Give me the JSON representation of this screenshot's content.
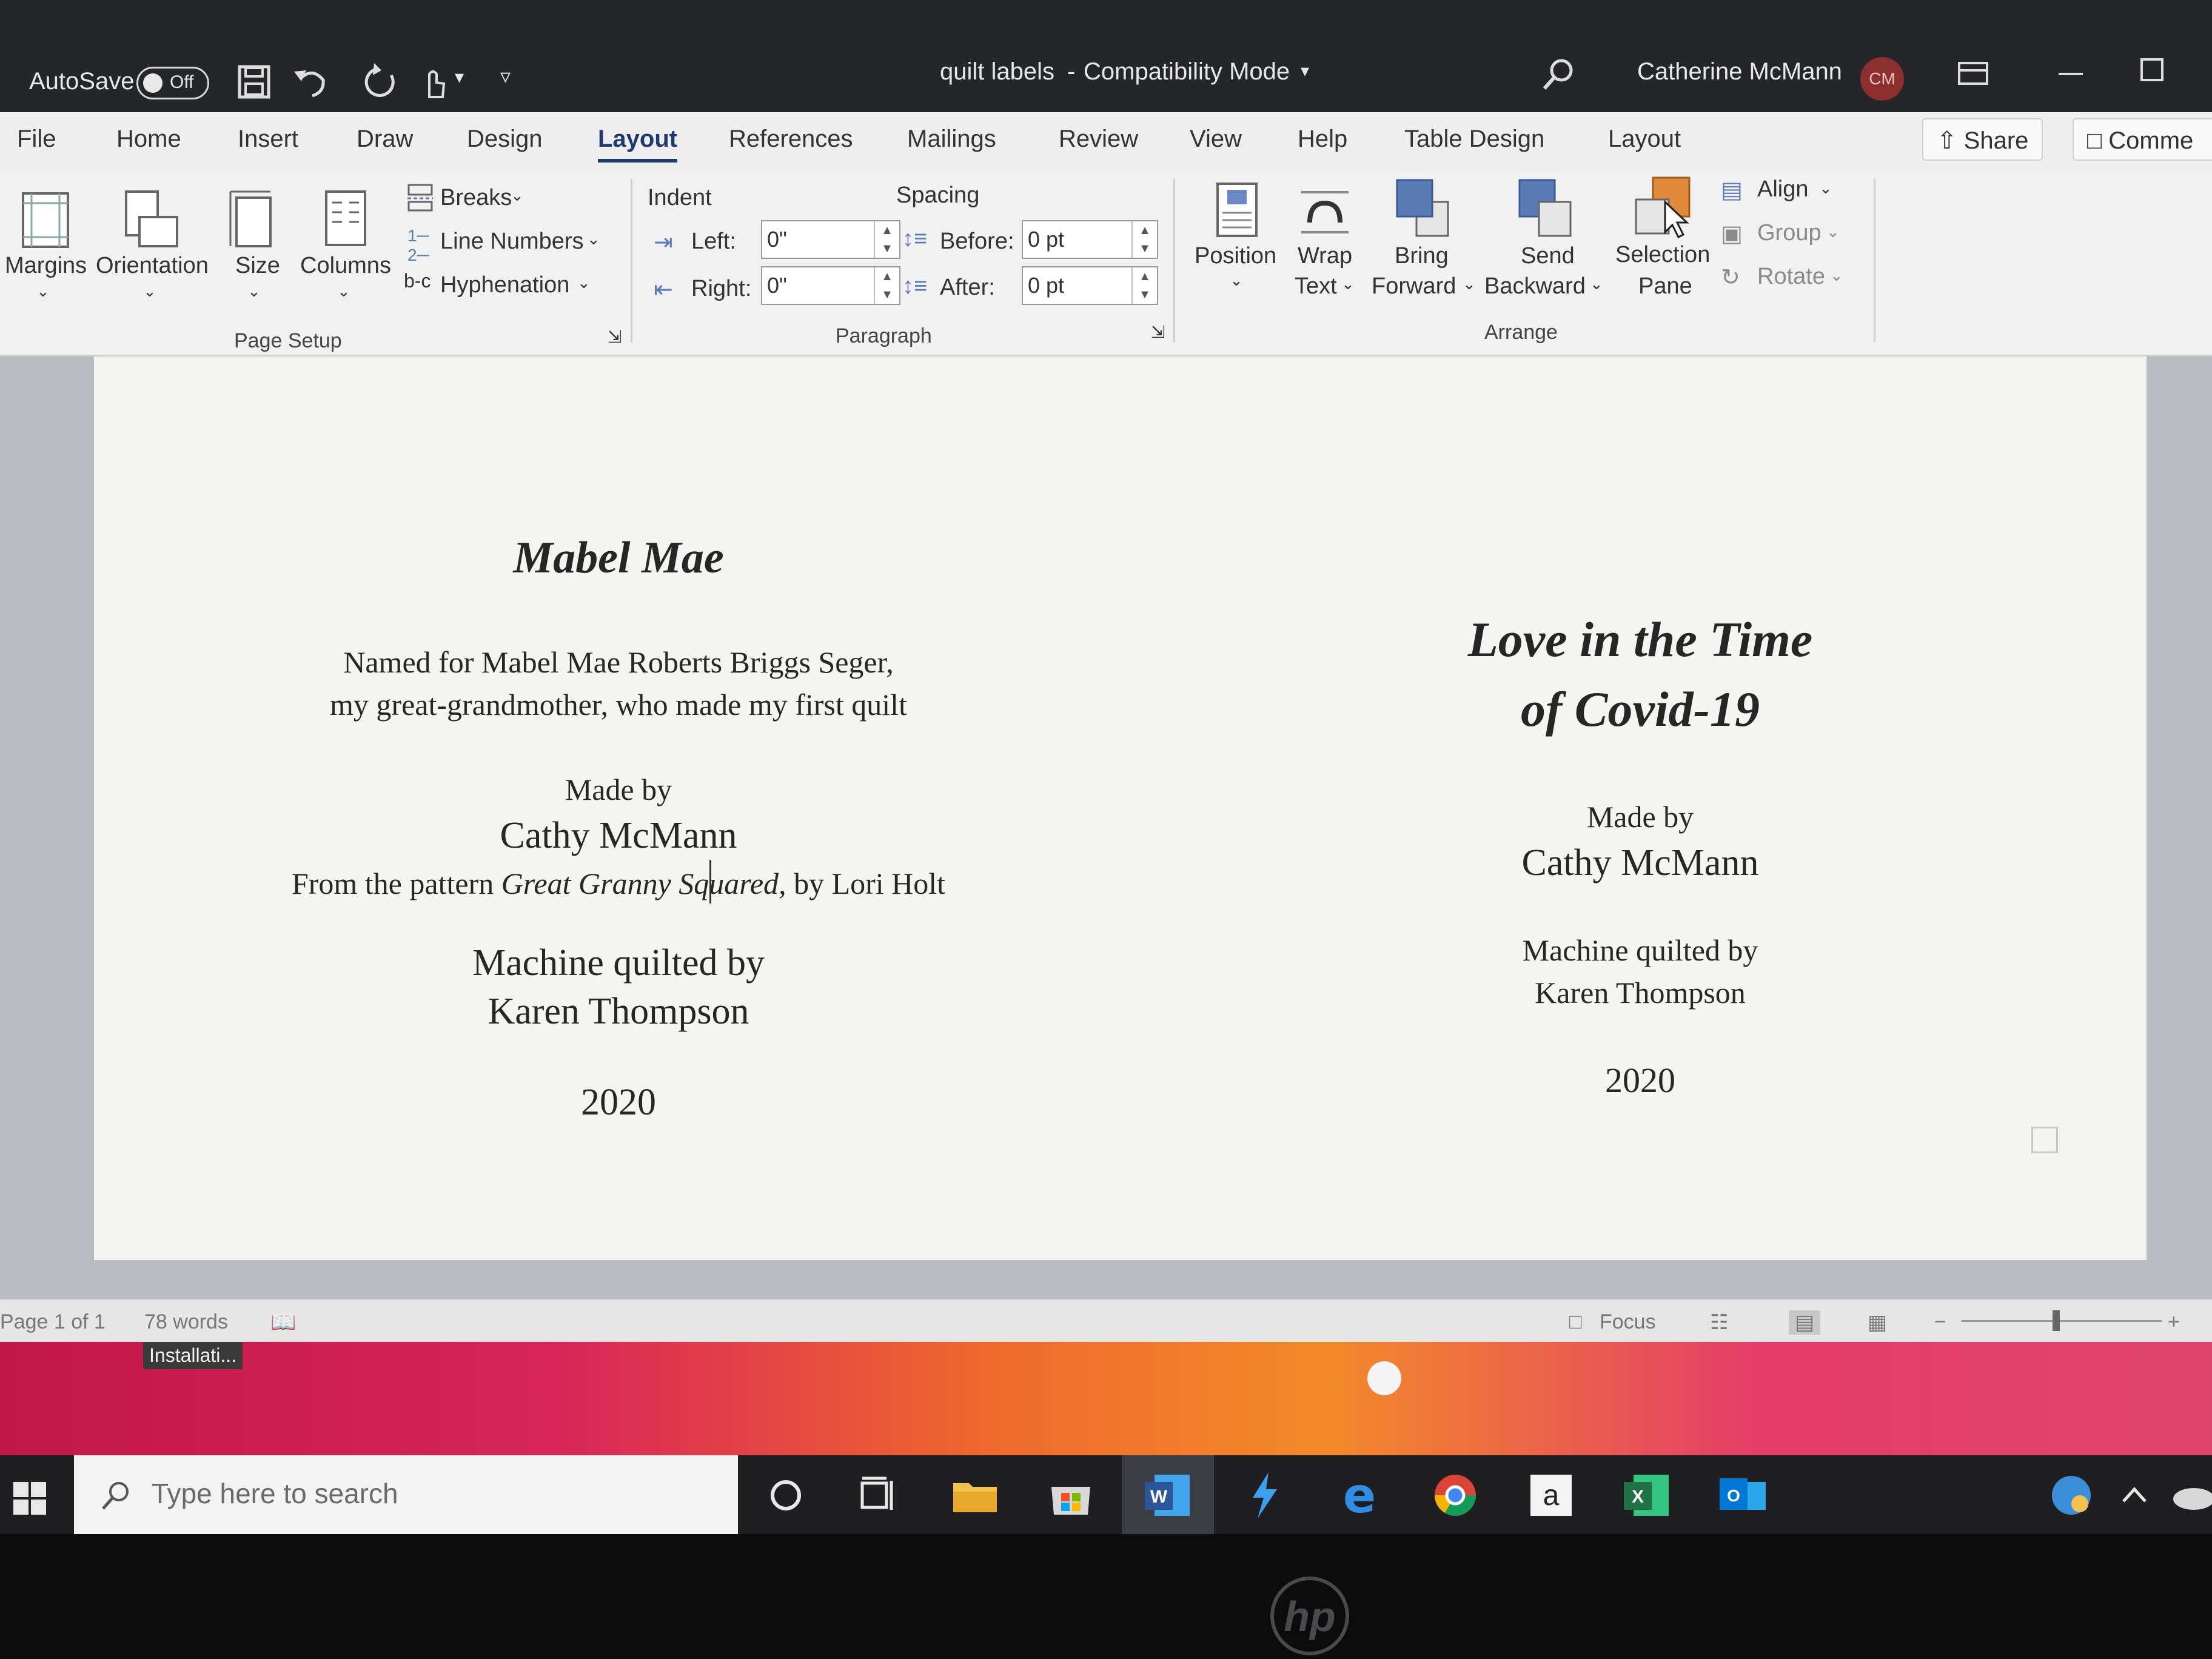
{
  "titlebar": {
    "autosave_label": "AutoSave",
    "autosave_state": "Off",
    "doc_title": "quilt labels",
    "separator": "-",
    "mode": "Compatibility Mode",
    "user_name": "Catherine McMann",
    "user_initials": "CM"
  },
  "ribbon_tabs": {
    "file": "File",
    "home": "Home",
    "insert": "Insert",
    "draw": "Draw",
    "design": "Design",
    "layout": "Layout",
    "references": "References",
    "mailings": "Mailings",
    "review": "Review",
    "view": "View",
    "help": "Help",
    "table_design": "Table Design",
    "table_layout": "Layout",
    "share": "Share",
    "comments": "Comme"
  },
  "page_setup": {
    "margins": "Margins",
    "orientation": "Orientation",
    "size": "Size",
    "columns": "Columns",
    "breaks": "Breaks",
    "line_numbers": "Line Numbers",
    "hyphenation": "Hyphenation",
    "group_label": "Page Setup"
  },
  "paragraph": {
    "indent_label": "Indent",
    "spacing_label": "Spacing",
    "left_label": "Left:",
    "right_label": "Right:",
    "before_label": "Before:",
    "after_label": "After:",
    "left_value": "0\"",
    "right_value": "0\"",
    "before_value": "0 pt",
    "after_value": "0 pt",
    "group_label": "Paragraph"
  },
  "arrange": {
    "position": "Position",
    "wrap_1": "Wrap",
    "wrap_2": "Text",
    "bring_1": "Bring",
    "bring_2": "Forward",
    "send_1": "Send",
    "send_2": "Backward",
    "selection_1": "Selection",
    "selection_2": "Pane",
    "align": "Align",
    "group": "Group",
    "rotate": "Rotate",
    "group_label": "Arrange"
  },
  "document": {
    "left_label": {
      "title": "Mabel Mae",
      "line1": "Named for Mabel Mae Roberts Briggs Seger,",
      "line2": "my great-grandmother, who made my first quilt",
      "made_by": "Made by",
      "maker": "Cathy McMann",
      "pattern_prefix": "From the pattern ",
      "pattern_name": "Great Granny Squared,",
      "pattern_suffix": " by Lori Holt",
      "quilted_by": "Machine quilted by",
      "quilter": "Karen Thompson",
      "year": "2020"
    },
    "right_label": {
      "title_line1": "Love in the Time",
      "title_line2": "of Covid-19",
      "made_by": "Made by",
      "maker": "Cathy McMann",
      "quilted_by": "Machine quilted by",
      "quilter": "Karen Thompson",
      "year": "2020"
    }
  },
  "statusbar": {
    "page": "Page 1 of 1",
    "words": "78 words",
    "focus": "Focus"
  },
  "desktop": {
    "installing": "Installati..."
  },
  "taskbar": {
    "search_placeholder": "Type here to search"
  },
  "bezel": {
    "brand": "hp"
  },
  "colors": {
    "titlebar_bg": "#24262a",
    "ribbon_bg": "#f1f1f1",
    "accent": "#1f3a6e",
    "word_blue": "#2b579a",
    "excel_green": "#217346"
  }
}
